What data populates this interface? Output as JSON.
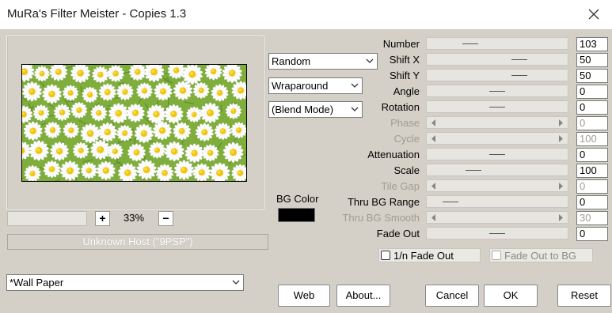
{
  "window": {
    "title": "MuRa's Filter Meister - Copies 1.3"
  },
  "icons": {
    "close": "close-icon",
    "plus": "plus-icon",
    "minus": "minus-icon",
    "dropdown": "chevron-down-icon",
    "arrow_left": "arrow-left-icon",
    "arrow_right": "arrow-right-icon"
  },
  "colors": {
    "bg_color_swatch": "#000000",
    "window_bg": "#d4d0c8"
  },
  "zoom": {
    "value": "33%",
    "plus": "+",
    "minus": "−"
  },
  "host": {
    "text": "Unknown Host (\"9PSP\")"
  },
  "dropdowns": {
    "mode": "Random",
    "edge": "Wraparound",
    "blend": "(Blend Mode)",
    "preset": "*Wall Paper"
  },
  "bg_color": {
    "label": "BG Color"
  },
  "params": [
    {
      "label": "Number",
      "value": "103",
      "enabled": true,
      "level": 0.31
    },
    {
      "label": "Shift X",
      "value": "50",
      "enabled": true,
      "level": 0.66
    },
    {
      "label": "Shift Y",
      "value": "50",
      "enabled": true,
      "level": 0.66
    },
    {
      "label": "Angle",
      "value": "0",
      "enabled": true,
      "level": 0.5
    },
    {
      "label": "Rotation",
      "value": "0",
      "enabled": true,
      "level": 0.5
    },
    {
      "label": "Phase",
      "value": "0",
      "enabled": false,
      "level": 0
    },
    {
      "label": "Cycle",
      "value": "100",
      "enabled": false,
      "level": 0
    },
    {
      "label": "Attenuation",
      "value": "0",
      "enabled": true,
      "level": 0.5
    },
    {
      "label": "Scale",
      "value": "100",
      "enabled": true,
      "level": 0.33
    },
    {
      "label": "Tile Gap",
      "value": "0",
      "enabled": false,
      "level": 0
    },
    {
      "label": "Thru BG Range",
      "value": "0",
      "enabled": true,
      "level": 0.17
    },
    {
      "label": "Thru BG Smooth",
      "value": "30",
      "enabled": false,
      "level": 0
    },
    {
      "label": "Fade Out",
      "value": "0",
      "enabled": true,
      "level": 0.5
    }
  ],
  "checkboxes": [
    {
      "label": "1/n Fade Out",
      "checked": false,
      "enabled": true
    },
    {
      "label": "Fade Out to BG",
      "checked": false,
      "enabled": false
    }
  ],
  "buttons": {
    "web": "Web",
    "about": "About...",
    "cancel": "Cancel",
    "ok": "OK",
    "reset": "Reset"
  }
}
